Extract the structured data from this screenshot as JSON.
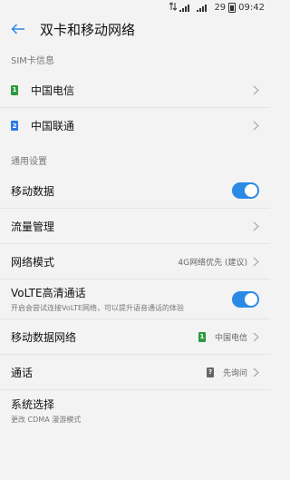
{
  "status_bar": {
    "battery": "29",
    "time": "09:42"
  },
  "header": {
    "title": "双卡和移动网络"
  },
  "sim_section": {
    "title": "SIM卡信息",
    "items": [
      {
        "badge": "1",
        "label": "中国电信",
        "badge_color": "#2a9a3c"
      },
      {
        "badge": "2",
        "label": "中国联通",
        "badge_color": "#2b7be0"
      }
    ]
  },
  "general_section": {
    "title": "通用设置",
    "mobile_data": {
      "label": "移动数据",
      "enabled": true
    },
    "data_usage": {
      "label": "流量管理"
    },
    "network_mode": {
      "label": "网络模式",
      "value": "4G网络优先 (建议)"
    },
    "volte": {
      "label": "VoLTE高清通话",
      "sub": "开启会尝试连接VoLTE网络，可以提升语音通话的体验",
      "enabled": true
    },
    "mobile_data_network": {
      "label": "移动数据网络",
      "badge": "1",
      "value": "中国电信"
    },
    "calls": {
      "label": "通话",
      "badge": "?",
      "value": "先询问"
    },
    "system_select": {
      "label": "系统选择",
      "sub": "更改 CDMA 漫游模式"
    }
  },
  "colors": {
    "accent": "#2b8ae6",
    "sim1": "#2a9a3c",
    "sim2": "#2b7be0"
  },
  "icons": [
    "back-arrow-icon",
    "chevron-right-icon",
    "signal-icon",
    "battery-icon"
  ]
}
